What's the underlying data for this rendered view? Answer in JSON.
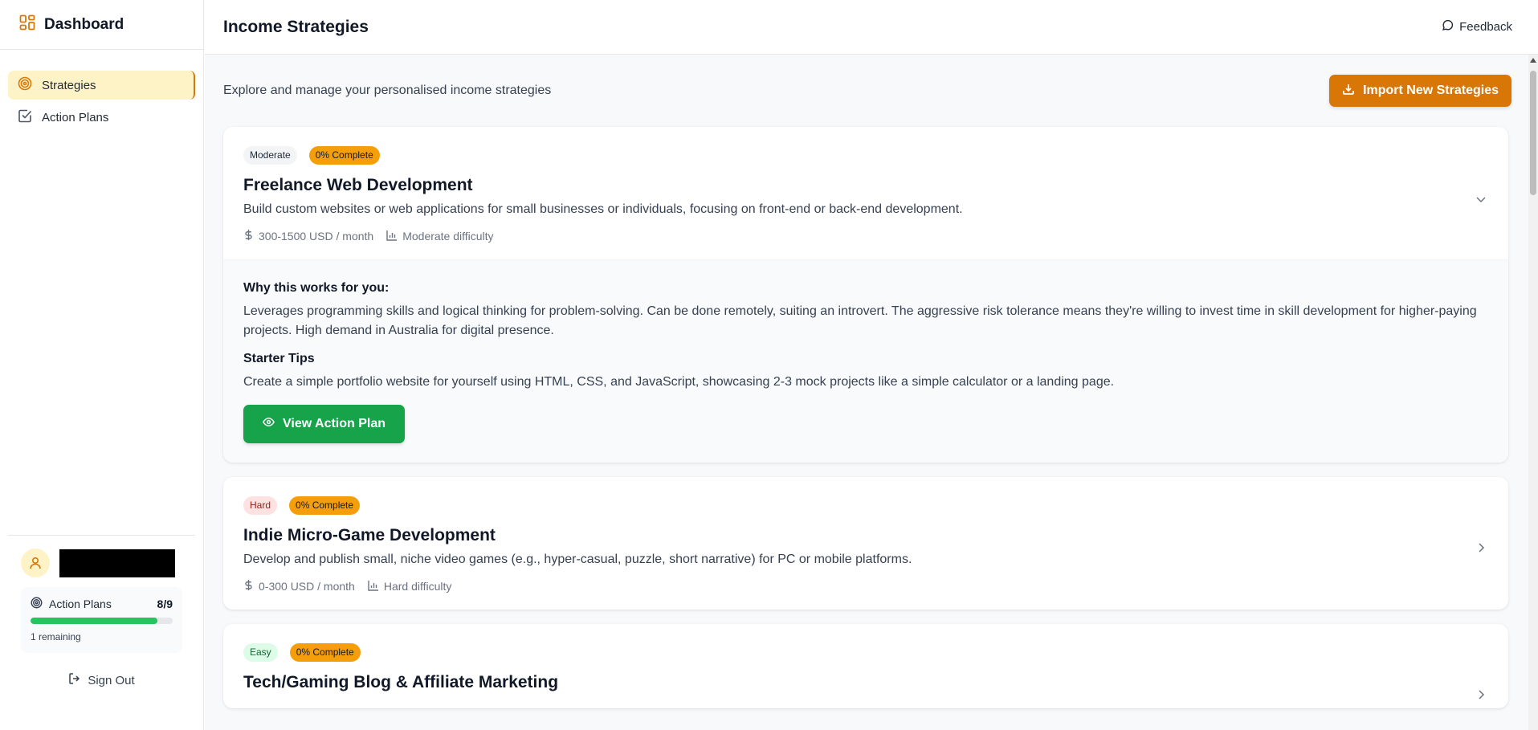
{
  "sidebar": {
    "brand": "Dashboard",
    "nav": [
      {
        "label": "Strategies",
        "icon": "target-icon",
        "active": true
      },
      {
        "label": "Action Plans",
        "icon": "checkbox-icon",
        "active": false
      }
    ],
    "action_plans": {
      "label": "Action Plans",
      "count": "8/9",
      "progress": 0.89,
      "remaining": "1 remaining"
    },
    "sign_out": "Sign Out"
  },
  "header": {
    "title": "Income Strategies",
    "feedback": "Feedback"
  },
  "subheader": {
    "subtitle": "Explore and manage your personalised income strategies",
    "import_button": "Import New Strategies"
  },
  "strategies": [
    {
      "difficulty_badge": "Moderate",
      "complete_badge": "0% Complete",
      "title": "Freelance Web Development",
      "description": "Build custom websites or web applications for small businesses or individuals, focusing on front-end or back-end development.",
      "income": "300-1500 USD / month",
      "difficulty": "Moderate difficulty",
      "why_heading": "Why this works for you:",
      "why_text": "Leverages programming skills and logical thinking for problem-solving. Can be done remotely, suiting an introvert. The aggressive risk tolerance means they're willing to invest time in skill development for higher-paying projects. High demand in Australia for digital presence.",
      "tips_heading": "Starter Tips",
      "tips_text": "Create a simple portfolio website for yourself using HTML, CSS, and JavaScript, showcasing 2-3 mock projects like a simple calculator or a landing page.",
      "view_button": "View Action Plan"
    },
    {
      "difficulty_badge": "Hard",
      "complete_badge": "0% Complete",
      "title": "Indie Micro-Game Development",
      "description": "Develop and publish small, niche video games (e.g., hyper-casual, puzzle, short narrative) for PC or mobile platforms.",
      "income": "0-300 USD / month",
      "difficulty": "Hard difficulty"
    },
    {
      "difficulty_badge": "Easy",
      "complete_badge": "0% Complete",
      "title": "Tech/Gaming Blog & Affiliate Marketing"
    }
  ],
  "colors": {
    "accent": "#d97706",
    "success": "#16a34a",
    "progress": "#22c55e"
  }
}
